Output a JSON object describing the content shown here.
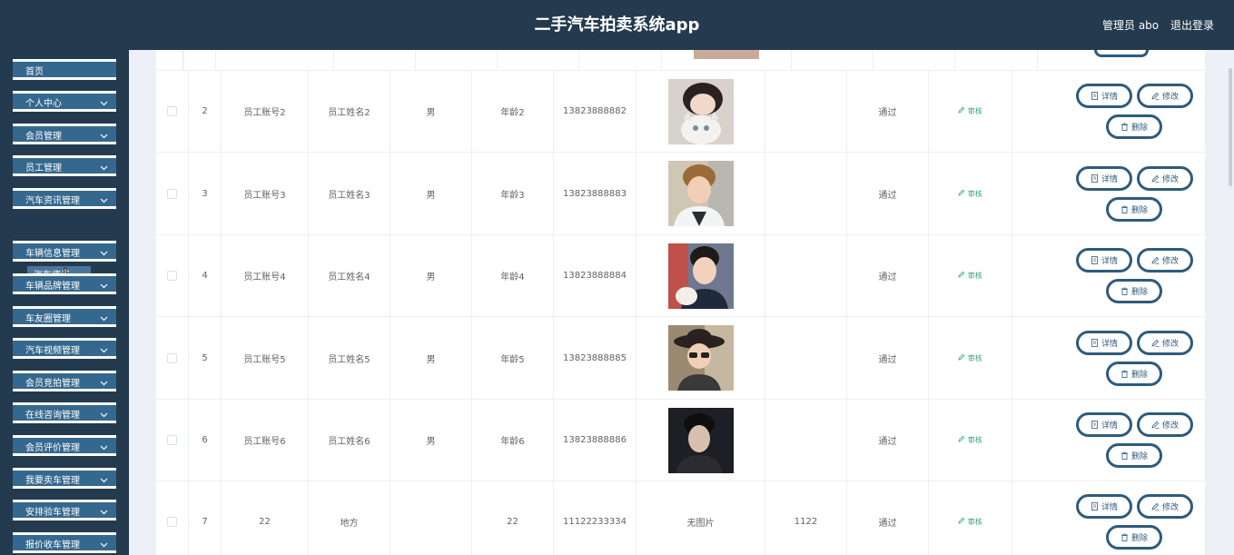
{
  "header": {
    "title": "二手汽车拍卖系统app",
    "admin_label": "管理员 abo",
    "logout_label": "退出登录"
  },
  "sidebar": {
    "items": [
      {
        "label": "首页",
        "has_chevron": false
      },
      {
        "label": "个人中心",
        "has_chevron": true
      },
      {
        "label": "会员管理",
        "has_chevron": true
      },
      {
        "label": "员工管理",
        "has_chevron": true
      },
      {
        "label": "汽车资讯管理",
        "has_chevron": true
      },
      {
        "label": "车辆信息管理",
        "has_chevron": true
      },
      {
        "label": "车辆品牌管理",
        "has_chevron": true
      },
      {
        "label": "车友圈管理",
        "has_chevron": true
      },
      {
        "label": "汽车视频管理",
        "has_chevron": true
      },
      {
        "label": "会员竞拍管理",
        "has_chevron": true
      },
      {
        "label": "在线咨询管理",
        "has_chevron": true
      },
      {
        "label": "会员评价管理",
        "has_chevron": true
      },
      {
        "label": "我要卖车管理",
        "has_chevron": true
      },
      {
        "label": "安排验车管理",
        "has_chevron": true
      },
      {
        "label": "报价收车管理",
        "has_chevron": true
      }
    ],
    "submenu_label": "汽车资讯"
  },
  "table": {
    "rows": [
      {
        "index": "2",
        "account": "员工账号2",
        "name": "员工姓名2",
        "gender": "男",
        "age": "年龄2",
        "phone": "13823888882",
        "photo": "avatar-cat",
        "extra": "",
        "status": "通过",
        "audit": "审核"
      },
      {
        "index": "3",
        "account": "员工账号3",
        "name": "员工姓名3",
        "gender": "男",
        "age": "年龄3",
        "phone": "13823888883",
        "photo": "avatar-boy",
        "extra": "",
        "status": "通过",
        "audit": "审核"
      },
      {
        "index": "4",
        "account": "员工账号4",
        "name": "员工姓名4",
        "gender": "男",
        "age": "年龄4",
        "phone": "13823888884",
        "photo": "avatar-man",
        "extra": "",
        "status": "通过",
        "audit": "审核"
      },
      {
        "index": "5",
        "account": "员工账号5",
        "name": "员工姓名5",
        "gender": "男",
        "age": "年龄5",
        "phone": "13823888885",
        "photo": "avatar-hat",
        "extra": "",
        "status": "通过",
        "audit": "审核"
      },
      {
        "index": "6",
        "account": "员工账号6",
        "name": "员工姓名6",
        "gender": "男",
        "age": "年龄6",
        "phone": "13823888886",
        "photo": "avatar-dark",
        "extra": "",
        "status": "通过",
        "audit": "审核"
      },
      {
        "index": "7",
        "account": "22",
        "name": "地方",
        "gender": "",
        "age": "22",
        "phone": "11122233334",
        "photo": "无图片",
        "extra": "1122",
        "status": "通过",
        "audit": "审核"
      }
    ],
    "buttons": {
      "detail": "详情",
      "edit": "修改",
      "delete": "删除"
    }
  },
  "colors": {
    "header_bg": "#243a4e",
    "menu_bg": "#35688e",
    "button_border": "#2f5b7c",
    "audit": "#3aa07a"
  }
}
